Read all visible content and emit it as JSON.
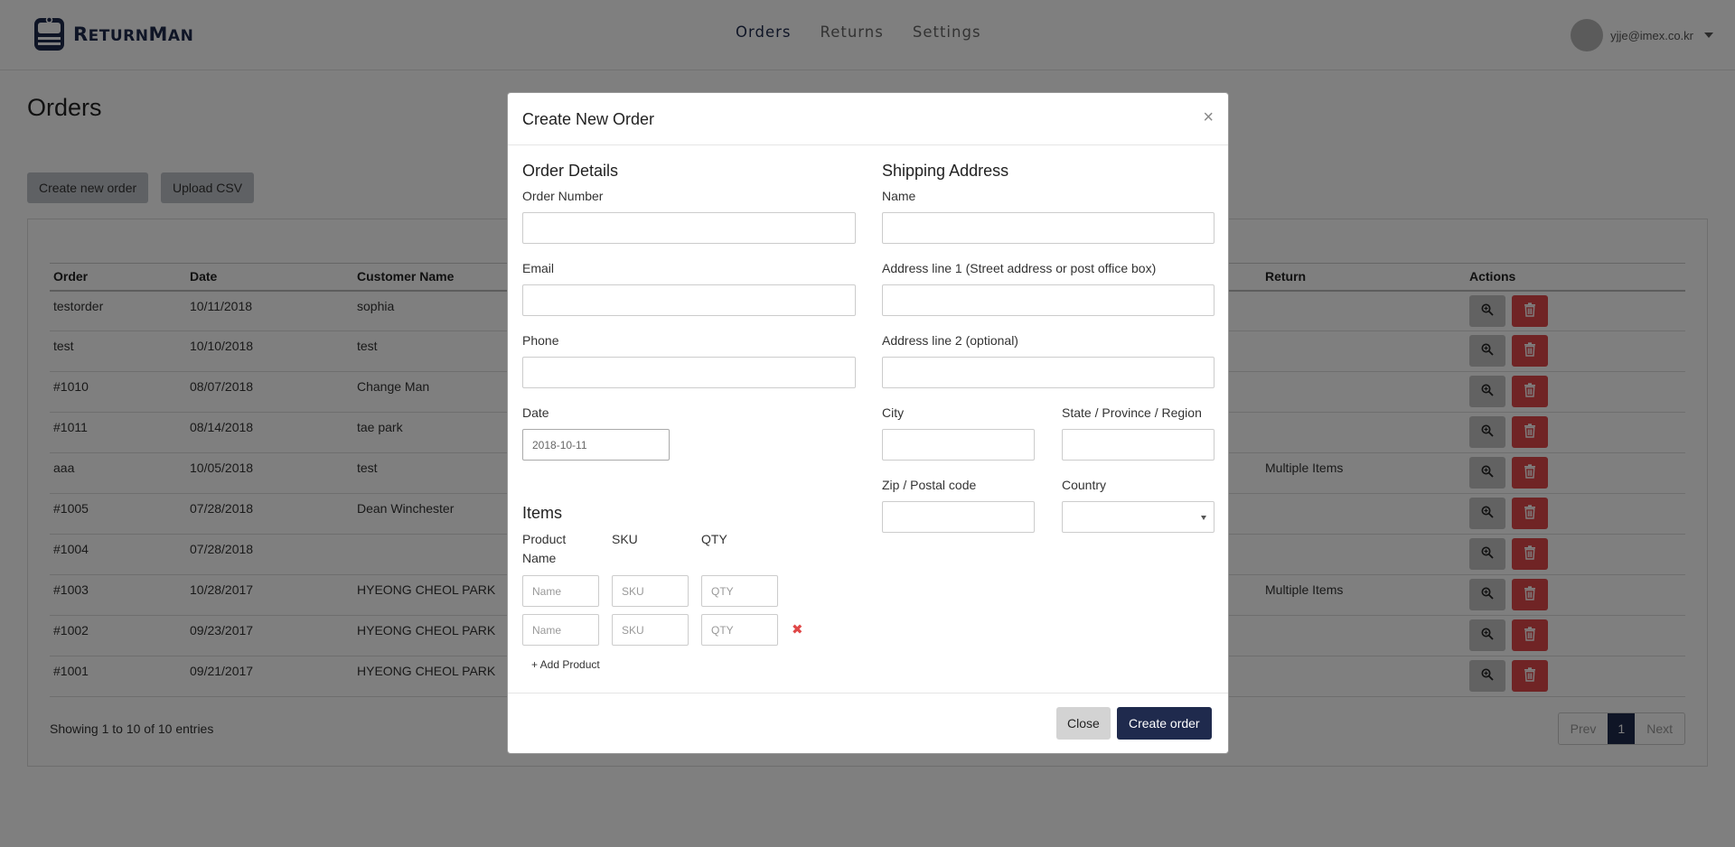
{
  "app": {
    "brand_big": "R",
    "brand_rest": "ETURN",
    "brand_big2": "M",
    "brand_rest2": "AN"
  },
  "nav": {
    "items": [
      "Orders",
      "Returns",
      "Settings"
    ],
    "active": "Orders"
  },
  "user": {
    "email": "yjje@imex.co.kr"
  },
  "page": {
    "title": "Orders",
    "create_button": "Create new order",
    "upload_button": "Upload CSV"
  },
  "table": {
    "headers": [
      "Order",
      "Date",
      "Customer Name",
      "Return",
      "Actions"
    ],
    "rows": [
      {
        "order": "testorder",
        "date": "10/11/2018",
        "customer": "sophia",
        "return": ""
      },
      {
        "order": "test",
        "date": "10/10/2018",
        "customer": "test",
        "return": ""
      },
      {
        "order": "#1010",
        "date": "08/07/2018",
        "customer": "Change Man",
        "return": ""
      },
      {
        "order": "#1011",
        "date": "08/14/2018",
        "customer": "tae park",
        "return": ""
      },
      {
        "order": "aaa",
        "date": "10/05/2018",
        "customer": "test",
        "return": "Multiple Items"
      },
      {
        "order": "#1005",
        "date": "07/28/2018",
        "customer": "Dean Winchester",
        "return": ""
      },
      {
        "order": "#1004",
        "date": "07/28/2018",
        "customer": "",
        "return": ""
      },
      {
        "order": "#1003",
        "date": "10/28/2017",
        "customer": "HYEONG CHEOL PARK",
        "return": "Multiple Items"
      },
      {
        "order": "#1002",
        "date": "09/23/2017",
        "customer": "HYEONG CHEOL PARK",
        "return": ""
      },
      {
        "order": "#1001",
        "date": "09/21/2017",
        "customer": "HYEONG CHEOL PARK",
        "return": ""
      }
    ],
    "showing": "Showing 1 to 10 of 10 entries",
    "pager": {
      "prev": "Prev",
      "current": "1",
      "next": "Next"
    }
  },
  "modal": {
    "title": "Create New Order",
    "close_symbol": "×",
    "order_details": {
      "heading": "Order Details",
      "order_number_label": "Order Number",
      "order_number_value": "",
      "email_label": "Email",
      "email_value": "",
      "phone_label": "Phone",
      "phone_value": "",
      "date_label": "Date",
      "date_value": "2018-10-11"
    },
    "items": {
      "heading": "Items",
      "col_product": "Product",
      "col_product2": "Name",
      "col_sku": "SKU",
      "col_qty": "QTY",
      "rows": [
        {
          "name_ph": "Name",
          "sku_ph": "SKU",
          "qty_ph": "QTY",
          "removable": false
        },
        {
          "name_ph": "Name",
          "sku_ph": "SKU",
          "qty_ph": "QTY",
          "removable": true
        }
      ],
      "remove_symbol": "✖",
      "add_product": "+ Add Product"
    },
    "shipping": {
      "heading": "Shipping Address",
      "name_label": "Name",
      "address1_label": "Address line 1 (Street address or post office box)",
      "address2_label": "Address line 2 (optional)",
      "city_label": "City",
      "state_label": "State / Province / Region",
      "zip_label": "Zip / Postal code",
      "country_label": "Country",
      "country_value": ""
    },
    "footer": {
      "close_button": "Close",
      "create_button": "Create order"
    }
  },
  "colors": {
    "brand": "#1f2a4d",
    "delete": "#e0484a",
    "remove": "#e04848"
  }
}
